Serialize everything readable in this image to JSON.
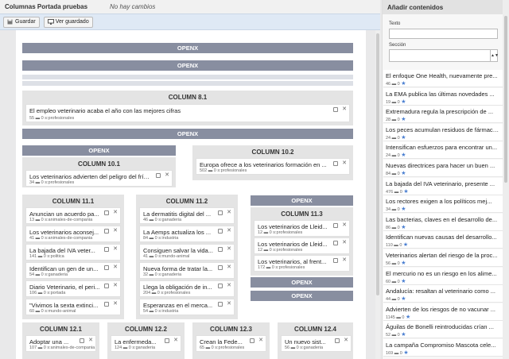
{
  "header": {
    "title": "Columnas Portada pruebas",
    "status": "No hay cambios"
  },
  "toolbar": {
    "save_label": "Guardar",
    "view_saved_label": "Ver guardado"
  },
  "bars": {
    "openx": "OPENX"
  },
  "columns": {
    "c81": "COLUMN 8.1",
    "c101": "COLUMN 10.1",
    "c102": "COLUMN 10.2",
    "c111": "COLUMN 11.1",
    "c112": "COLUMN 11.2",
    "c113": "COLUMN 11.3",
    "c121": "COLUMN 12.1",
    "c122": "COLUMN 12.2",
    "c123": "COLUMN 12.3",
    "c124": "COLUMN 12.4"
  },
  "cards": {
    "c81": [
      {
        "title": "El empleo veterinario acaba el año con las mejores cifras",
        "meta": "55 ▬ 0 s:profesionales"
      }
    ],
    "c101": [
      {
        "title": "Los veterinarios advierten del peligro del frío ...",
        "meta": "34 ▬ 0 s:profesionales"
      }
    ],
    "c102": [
      {
        "title": "Europa ofrece a los veterinarios formación en ...",
        "meta": "502 ▬ 0 s:profesionales"
      }
    ],
    "c111": [
      {
        "title": "Anuncian un acuerdo pa...",
        "meta": "13 ▬ 0 s:animales-de-compania"
      },
      {
        "title": "Los veterinarios aconsej...",
        "meta": "41 ▬ 0 s:animales-de-compania"
      },
      {
        "title": "La bajada del IVA veter...",
        "meta": "141 ▬ 0 s:politica"
      },
      {
        "title": "Identifican un gen de un...",
        "meta": "54 ▬ 0 s:ganaderia"
      },
      {
        "title": "Diario Veterinario, el peri...",
        "meta": "106 ▬ 0 s:portada"
      },
      {
        "title": "\"Vivimos la sexta extinci...",
        "meta": "60 ▬ 0 s:mundo-animal"
      }
    ],
    "c112": [
      {
        "title": "La dermatitis digital del ...",
        "meta": "46 ▬ 0 s:ganaderia"
      },
      {
        "title": "La Aemps actualiza los ...",
        "meta": "84 ▬ 0 s:industria"
      },
      {
        "title": "Consiguen salvar la vida...",
        "meta": "41 ▬ 0 s:mundo-animal"
      },
      {
        "title": "Nueva forma de tratar la...",
        "meta": "32 ▬ 0 s:ganaderia"
      },
      {
        "title": "Llega la obligación de in...",
        "meta": "204 ▬ 0 s:profesionales"
      },
      {
        "title": "Esperanzas en el merca...",
        "meta": "54 ▬ 0 s:industria"
      }
    ],
    "c113": [
      {
        "title": "Los veterinarios de Lleid...",
        "meta": "12 ▬ 0 s:profesionales"
      },
      {
        "title": "Los veterinarios de Lleid...",
        "meta": "12 ▬ 0 s:profesionales"
      },
      {
        "title": "Los veterinarios, al frent...",
        "meta": "172 ▬ 0 s:profesionales"
      }
    ],
    "c121": [
      {
        "title": "Adoptar una ...",
        "meta": "107 ▬ 0 s:animales-de-compania"
      }
    ],
    "c122": [
      {
        "title": "La enfermeda...",
        "meta": "124 ▬ 0 s:ganaderia"
      }
    ],
    "c123": [
      {
        "title": "Crean la Fede...",
        "meta": "65 ▬ 0 s:profesionales"
      }
    ],
    "c124": [
      {
        "title": "Un nuevo sist...",
        "meta": "56 ▬ 0 s:ganaderia"
      }
    ]
  },
  "sidebar": {
    "title": "Añadir contenidos",
    "text_label": "Texto",
    "text_value": "",
    "section_label": "Sección",
    "section_value": "",
    "items": [
      {
        "title": "El enfoque One Health, nuevamente pre...",
        "meta": "46 ▬ 0"
      },
      {
        "title": "La EMA publica las últimas novedades ...",
        "meta": "19 ▬ 0"
      },
      {
        "title": "Extremadura regula la prescripción de ...",
        "meta": "28 ▬ 0"
      },
      {
        "title": "Los peces acumulan residuos de fármacos...",
        "meta": "24 ▬ 0"
      },
      {
        "title": "Intensifican esfuerzos para encontrar un...",
        "meta": "24 ▬ 0"
      },
      {
        "title": "Nuevas directrices para hacer un buen ...",
        "meta": "84 ▬ 0"
      },
      {
        "title": "La bajada del IVA veterinario, presente ...",
        "meta": "476 ▬ 0"
      },
      {
        "title": "Los rectores exigen a los políticos mej...",
        "meta": "34 ▬ 0"
      },
      {
        "title": "Las bacterias, claves en el desarrollo de...",
        "meta": "86 ▬ 0"
      },
      {
        "title": "Identifican nuevas causas del desarrollo...",
        "meta": "110 ▬ 0"
      },
      {
        "title": "Veterinarios alertan del riesgo de la proc...",
        "meta": "56 ▬ 0"
      },
      {
        "title": "El mercurio no es un riesgo en los alime...",
        "meta": "60 ▬ 0"
      },
      {
        "title": "Andalucía: resaltan al veterinario como ...",
        "meta": "44 ▬ 0"
      },
      {
        "title": "Advierten de los riesgos de no vacunar ...",
        "meta": "1145 ▬ 0"
      },
      {
        "title": "Águilas de Bonelli reintroducidas crían ...",
        "meta": "52 ▬ 0"
      },
      {
        "title": "La campaña Compromiso Mascota cele...",
        "meta": "169 ▬ 0"
      }
    ]
  }
}
